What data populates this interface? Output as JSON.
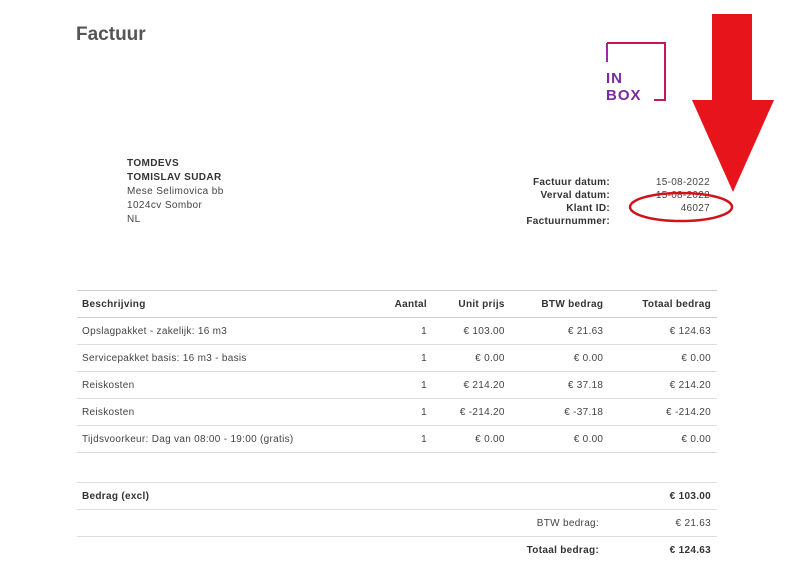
{
  "doc": {
    "title": "Factuur"
  },
  "logo": {
    "line1": "IN",
    "line2": "BOX",
    "color": "#7a2aa3",
    "accent": "#c2185b"
  },
  "client": {
    "company": "TOMDEVS",
    "name": "TOMISLAV SUDAR",
    "street": "Mese Selimovica bb",
    "city": "1024cv Sombor",
    "country": "NL"
  },
  "meta": {
    "invoice_date_label": "Factuur datum:",
    "invoice_date": "15-08-2022",
    "due_date_label": "Verval datum:",
    "due_date": "15-08-2022",
    "client_id_label": "Klant ID:",
    "client_id": "46027",
    "invoice_number_label": "Factuurnummer:",
    "invoice_number": ""
  },
  "annotations": {
    "arrow_color": "#e8141c",
    "ellipse_color": "#d0131b"
  },
  "table": {
    "headers": [
      "Beschrijving",
      "Aantal",
      "Unit prijs",
      "BTW bedrag",
      "Totaal bedrag"
    ],
    "rows": [
      [
        "Opslagpakket - zakelijk: 16 m3",
        "1",
        "€ 103.00",
        "€ 21.63",
        "€ 124.63"
      ],
      [
        "Servicepakket basis: 16 m3 - basis",
        "1",
        "€ 0.00",
        "€ 0.00",
        "€ 0.00"
      ],
      [
        "Reiskosten",
        "1",
        "€ 214.20",
        "€ 37.18",
        "€ 214.20"
      ],
      [
        "Reiskosten",
        "1",
        "€ -214.20",
        "€ -37.18",
        "€ -214.20"
      ],
      [
        "Tijdsvoorkeur: Dag van 08:00 - 19:00 (gratis)",
        "1",
        "€ 0.00",
        "€ 0.00",
        "€ 0.00"
      ]
    ]
  },
  "totals": {
    "excl_label": "Bedrag (excl)",
    "excl_value": "€ 103.00",
    "btw_label": "BTW bedrag:",
    "btw_value": "€ 21.63",
    "total_label": "Totaal bedrag:",
    "total_value": "€ 124.63"
  }
}
